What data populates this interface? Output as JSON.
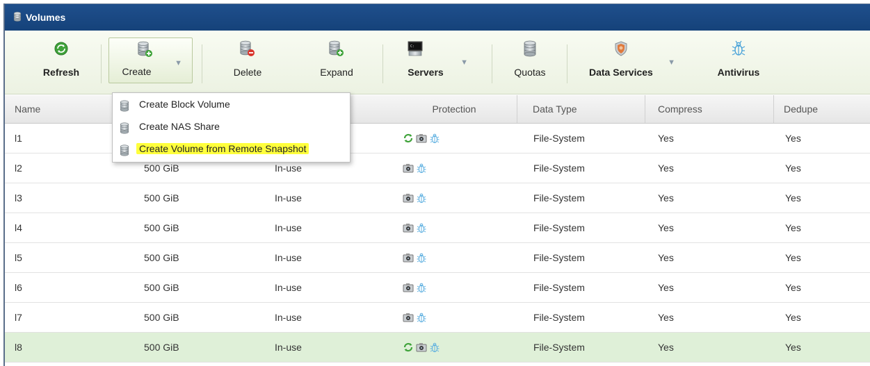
{
  "window": {
    "title": "Volumes",
    "icon": "database-icon"
  },
  "toolbar": {
    "refresh": {
      "label": "Refresh",
      "icon": "refresh-icon"
    },
    "create": {
      "label": "Create",
      "icon": "create-volume-icon"
    },
    "delete": {
      "label": "Delete",
      "icon": "delete-volume-icon"
    },
    "expand": {
      "label": "Expand",
      "icon": "expand-volume-icon"
    },
    "servers": {
      "label": "Servers",
      "icon": "server-icon"
    },
    "quotas": {
      "label": "Quotas",
      "icon": "quota-icon"
    },
    "data_services": {
      "label": "Data Services",
      "icon": "shield-icon"
    },
    "antivirus": {
      "label": "Antivirus",
      "icon": "bug-icon"
    },
    "caret": "▼"
  },
  "create_menu": {
    "items": [
      {
        "label": "Create Block Volume",
        "icon": "block-volume-icon"
      },
      {
        "label": "Create NAS Share",
        "icon": "nas-share-icon"
      },
      {
        "label": "Create Volume from Remote Snapshot",
        "icon": "snapshot-volume-icon",
        "highlighted": true
      }
    ]
  },
  "table": {
    "columns": [
      "Name",
      "Protection",
      "Data Type",
      "Compress",
      "Dedupe"
    ],
    "rows": [
      {
        "name": "l1",
        "size": "",
        "status": "",
        "protection": [
          "replication-icon",
          "snapshot-icon",
          "antivirus-icon"
        ],
        "data_type": "File-System",
        "compress": "Yes",
        "dedupe": "Yes"
      },
      {
        "name": "l2",
        "size": "500 GiB",
        "status": "In-use",
        "protection": [
          "snapshot-icon",
          "antivirus-icon"
        ],
        "data_type": "File-System",
        "compress": "Yes",
        "dedupe": "Yes"
      },
      {
        "name": "l3",
        "size": "500 GiB",
        "status": "In-use",
        "protection": [
          "snapshot-icon",
          "antivirus-icon"
        ],
        "data_type": "File-System",
        "compress": "Yes",
        "dedupe": "Yes"
      },
      {
        "name": "l4",
        "size": "500 GiB",
        "status": "In-use",
        "protection": [
          "snapshot-icon",
          "antivirus-icon"
        ],
        "data_type": "File-System",
        "compress": "Yes",
        "dedupe": "Yes"
      },
      {
        "name": "l5",
        "size": "500 GiB",
        "status": "In-use",
        "protection": [
          "snapshot-icon",
          "antivirus-icon"
        ],
        "data_type": "File-System",
        "compress": "Yes",
        "dedupe": "Yes"
      },
      {
        "name": "l6",
        "size": "500 GiB",
        "status": "In-use",
        "protection": [
          "snapshot-icon",
          "antivirus-icon"
        ],
        "data_type": "File-System",
        "compress": "Yes",
        "dedupe": "Yes"
      },
      {
        "name": "l7",
        "size": "500 GiB",
        "status": "In-use",
        "protection": [
          "snapshot-icon",
          "antivirus-icon"
        ],
        "data_type": "File-System",
        "compress": "Yes",
        "dedupe": "Yes"
      },
      {
        "name": "l8",
        "size": "500 GiB",
        "status": "In-use",
        "protection": [
          "replication-icon",
          "snapshot-icon",
          "antivirus-icon"
        ],
        "data_type": "File-System",
        "compress": "Yes",
        "dedupe": "Yes",
        "selected": true
      }
    ]
  },
  "colors": {
    "titlebar": "#1a4a86",
    "selected_row": "#dff0d8",
    "highlight": "#ffff3c"
  }
}
